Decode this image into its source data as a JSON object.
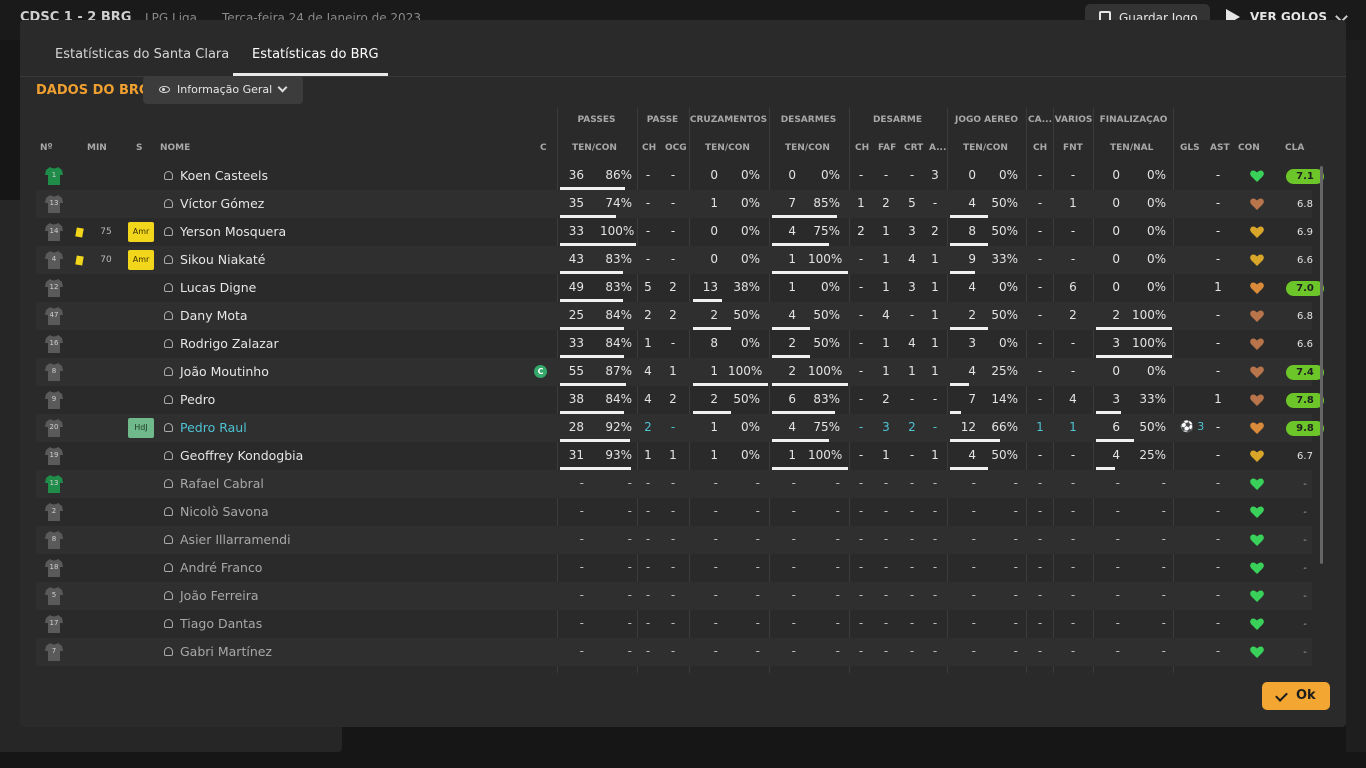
{
  "topbar": {
    "score": "CDSC 1 - 2 BRG",
    "competition": "LPG Liga",
    "date": "Terça-feira 24 de Janeiro de 2023",
    "save_label": "Guardar Jogo",
    "goals_label": "VER GOLOS"
  },
  "tabs": [
    "Estatísticas do Santa Clara",
    "Estatísticas do BRG"
  ],
  "section_title": "DADOS DO BRG",
  "view_select": "Informação Geral",
  "groups": [
    "PASSES",
    "PASSE",
    "CRUZAMENTOS",
    "DESARMES",
    "DESARME",
    "JOGO AÉREO",
    "CA...",
    "VÁRIOS",
    "FINALIZAÇÃO"
  ],
  "headers": {
    "num": "Nº",
    "min": "MIN",
    "s": "S",
    "name": "NOME",
    "c": "C",
    "passes": "TEN/CON",
    "passe_ch": "CH",
    "passe_ocg": "OCG",
    "cruz": "TEN/CON",
    "desarmes": "TEN/CON",
    "d_ch": "CH",
    "d_faf": "FAF",
    "d_crt": "CRT",
    "d_a": "A...",
    "aereo": "TEN/CON",
    "ca_ch": "CH",
    "v_fnt": "FNT",
    "finalizacao": "TEN/NAL",
    "gls": "GLS",
    "ast": "AST",
    "con": "CON",
    "cla": "CLA"
  },
  "players": [
    {
      "num": "1",
      "gk": true,
      "min": "",
      "card": false,
      "badge": "",
      "name": "Koen Casteels",
      "cap": false,
      "hl": false,
      "p_t": "36",
      "p_c": "86%",
      "p_bar": 0.86,
      "ch": "-",
      "ocg": "-",
      "cz_t": "0",
      "cz_c": "0%",
      "cz_bar": 0,
      "ds_t": "0",
      "ds_c": "0%",
      "ds_bar": 0,
      "d_ch": "-",
      "faf": "-",
      "crt": "-",
      "a": "3",
      "ae_t": "0",
      "ae_c": "0%",
      "ae_bar": 0,
      "ca_ch": "-",
      "fnt": "-",
      "f_t": "0",
      "f_c": "0%",
      "f_bar": 0,
      "gls": "",
      "ast": "-",
      "heart": "#3ad15a",
      "cla": "7.1",
      "cla_green": true
    },
    {
      "num": "13",
      "gk": false,
      "min": "",
      "card": false,
      "badge": "",
      "name": "Víctor Gómez",
      "cap": false,
      "hl": false,
      "p_t": "35",
      "p_c": "74%",
      "p_bar": 0.74,
      "ch": "-",
      "ocg": "-",
      "cz_t": "1",
      "cz_c": "0%",
      "cz_bar": 0,
      "ds_t": "7",
      "ds_c": "85%",
      "ds_bar": 0.85,
      "d_ch": "1",
      "faf": "2",
      "crt": "5",
      "a": "-",
      "ae_t": "4",
      "ae_c": "50%",
      "ae_bar": 0.5,
      "ca_ch": "-",
      "fnt": "1",
      "f_t": "0",
      "f_c": "0%",
      "f_bar": 0,
      "gls": "",
      "ast": "-",
      "heart": "#b8744a",
      "cla": "6.8",
      "cla_green": false
    },
    {
      "num": "14",
      "gk": false,
      "min": "75",
      "card": true,
      "badge": "Amr",
      "name": "Yerson Mosquera",
      "cap": false,
      "hl": false,
      "p_t": "33",
      "p_c": "100%",
      "p_bar": 1,
      "ch": "-",
      "ocg": "-",
      "cz_t": "0",
      "cz_c": "0%",
      "cz_bar": 0,
      "ds_t": "4",
      "ds_c": "75%",
      "ds_bar": 0.75,
      "d_ch": "2",
      "faf": "1",
      "crt": "3",
      "a": "2",
      "ae_t": "8",
      "ae_c": "50%",
      "ae_bar": 0.5,
      "ca_ch": "-",
      "fnt": "-",
      "f_t": "0",
      "f_c": "0%",
      "f_bar": 0,
      "gls": "",
      "ast": "-",
      "heart": "#d9a62a",
      "cla": "6.9",
      "cla_green": false
    },
    {
      "num": "4",
      "gk": false,
      "min": "70",
      "card": true,
      "badge": "Amr",
      "name": "Sikou Niakaté",
      "cap": false,
      "hl": false,
      "p_t": "43",
      "p_c": "83%",
      "p_bar": 0.83,
      "ch": "-",
      "ocg": "-",
      "cz_t": "0",
      "cz_c": "0%",
      "cz_bar": 0,
      "ds_t": "1",
      "ds_c": "100%",
      "ds_bar": 1,
      "d_ch": "-",
      "faf": "1",
      "crt": "4",
      "a": "1",
      "ae_t": "9",
      "ae_c": "33%",
      "ae_bar": 0.33,
      "ca_ch": "-",
      "fnt": "-",
      "f_t": "0",
      "f_c": "0%",
      "f_bar": 0,
      "gls": "",
      "ast": "-",
      "heart": "#d9a62a",
      "cla": "6.6",
      "cla_green": false
    },
    {
      "num": "12",
      "gk": false,
      "min": "",
      "card": false,
      "badge": "",
      "name": "Lucas Digne",
      "cap": false,
      "hl": false,
      "p_t": "49",
      "p_c": "83%",
      "p_bar": 0.83,
      "ch": "5",
      "ocg": "2",
      "cz_t": "13",
      "cz_c": "38%",
      "cz_bar": 0.38,
      "ds_t": "1",
      "ds_c": "0%",
      "ds_bar": 0,
      "d_ch": "-",
      "faf": "1",
      "crt": "3",
      "a": "1",
      "ae_t": "4",
      "ae_c": "0%",
      "ae_bar": 0,
      "ca_ch": "-",
      "fnt": "6",
      "f_t": "0",
      "f_c": "0%",
      "f_bar": 0,
      "gls": "",
      "ast": "1",
      "heart": "#d98a3a",
      "cla": "7.0",
      "cla_green": true
    },
    {
      "num": "47",
      "gk": false,
      "min": "",
      "card": false,
      "badge": "",
      "name": "Dany Mota",
      "cap": false,
      "hl": false,
      "p_t": "25",
      "p_c": "84%",
      "p_bar": 0.84,
      "ch": "2",
      "ocg": "2",
      "cz_t": "2",
      "cz_c": "50%",
      "cz_bar": 0.5,
      "ds_t": "4",
      "ds_c": "50%",
      "ds_bar": 0.5,
      "d_ch": "-",
      "faf": "4",
      "crt": "-",
      "a": "1",
      "ae_t": "2",
      "ae_c": "50%",
      "ae_bar": 0.5,
      "ca_ch": "-",
      "fnt": "2",
      "f_t": "2",
      "f_c": "100%",
      "f_bar": 1,
      "gls": "",
      "ast": "-",
      "heart": "#b8744a",
      "cla": "6.8",
      "cla_green": false
    },
    {
      "num": "16",
      "gk": false,
      "min": "",
      "card": false,
      "badge": "",
      "name": "Rodrigo Zalazar",
      "cap": false,
      "hl": false,
      "p_t": "33",
      "p_c": "84%",
      "p_bar": 0.84,
      "ch": "1",
      "ocg": "-",
      "cz_t": "8",
      "cz_c": "0%",
      "cz_bar": 0,
      "ds_t": "2",
      "ds_c": "50%",
      "ds_bar": 0.5,
      "d_ch": "-",
      "faf": "1",
      "crt": "4",
      "a": "1",
      "ae_t": "3",
      "ae_c": "0%",
      "ae_bar": 0,
      "ca_ch": "-",
      "fnt": "-",
      "f_t": "3",
      "f_c": "100%",
      "f_bar": 1,
      "gls": "",
      "ast": "-",
      "heart": "#b8744a",
      "cla": "6.6",
      "cla_green": false
    },
    {
      "num": "8",
      "gk": false,
      "min": "",
      "card": false,
      "badge": "",
      "name": "João Moutinho",
      "cap": true,
      "hl": false,
      "p_t": "55",
      "p_c": "87%",
      "p_bar": 0.87,
      "ch": "4",
      "ocg": "1",
      "cz_t": "1",
      "cz_c": "100%",
      "cz_bar": 1,
      "ds_t": "2",
      "ds_c": "100%",
      "ds_bar": 1,
      "d_ch": "-",
      "faf": "1",
      "crt": "1",
      "a": "1",
      "ae_t": "4",
      "ae_c": "25%",
      "ae_bar": 0.25,
      "ca_ch": "-",
      "fnt": "-",
      "f_t": "0",
      "f_c": "0%",
      "f_bar": 0,
      "gls": "",
      "ast": "-",
      "heart": "#b8744a",
      "cla": "7.4",
      "cla_green": true
    },
    {
      "num": "9",
      "gk": false,
      "min": "",
      "card": false,
      "badge": "",
      "name": "Pedro",
      "cap": false,
      "hl": false,
      "p_t": "38",
      "p_c": "84%",
      "p_bar": 0.84,
      "ch": "4",
      "ocg": "2",
      "cz_t": "2",
      "cz_c": "50%",
      "cz_bar": 0.5,
      "ds_t": "6",
      "ds_c": "83%",
      "ds_bar": 0.83,
      "d_ch": "-",
      "faf": "2",
      "crt": "-",
      "a": "-",
      "ae_t": "7",
      "ae_c": "14%",
      "ae_bar": 0.14,
      "ca_ch": "-",
      "fnt": "4",
      "f_t": "3",
      "f_c": "33%",
      "f_bar": 0.33,
      "gls": "",
      "ast": "1",
      "heart": "#b8744a",
      "cla": "7.8",
      "cla_green": true
    },
    {
      "num": "20",
      "gk": false,
      "min": "",
      "card": false,
      "badge": "HdJ",
      "name": "Pedro Raul",
      "cap": false,
      "hl": true,
      "p_t": "28",
      "p_c": "92%",
      "p_bar": 0.92,
      "ch": "2",
      "ocg": "-",
      "cz_t": "1",
      "cz_c": "0%",
      "cz_bar": 0,
      "ds_t": "4",
      "ds_c": "75%",
      "ds_bar": 0.75,
      "d_ch": "-",
      "faf": "3",
      "crt": "2",
      "a": "-",
      "ae_t": "12",
      "ae_c": "66%",
      "ae_bar": 0.66,
      "ca_ch": "1",
      "fnt": "1",
      "f_t": "6",
      "f_c": "50%",
      "f_bar": 0.5,
      "gls": "3",
      "ast": "-",
      "heart": "#d98a3a",
      "cla": "9.8",
      "cla_green": true
    },
    {
      "num": "19",
      "gk": false,
      "min": "",
      "card": false,
      "badge": "",
      "name": "Geoffrey Kondogbia",
      "cap": false,
      "hl": false,
      "p_t": "31",
      "p_c": "93%",
      "p_bar": 0.93,
      "ch": "1",
      "ocg": "1",
      "cz_t": "1",
      "cz_c": "0%",
      "cz_bar": 0,
      "ds_t": "1",
      "ds_c": "100%",
      "ds_bar": 1,
      "d_ch": "-",
      "faf": "1",
      "crt": "-",
      "a": "1",
      "ae_t": "4",
      "ae_c": "50%",
      "ae_bar": 0.5,
      "ca_ch": "-",
      "fnt": "-",
      "f_t": "4",
      "f_c": "25%",
      "f_bar": 0.25,
      "gls": "",
      "ast": "-",
      "heart": "#d9a62a",
      "cla": "6.7",
      "cla_green": false
    },
    {
      "num": "13",
      "gk": true,
      "min": "",
      "card": false,
      "badge": "",
      "name": "Rafael Cabral",
      "cap": false,
      "hl": false,
      "sub": true,
      "heart": "#3ad15a",
      "cla": "-",
      "cla_green": false
    },
    {
      "num": "2",
      "gk": false,
      "min": "",
      "card": false,
      "badge": "",
      "name": "Nicolò Savona",
      "cap": false,
      "hl": false,
      "sub": true,
      "heart": "#3ad15a",
      "cla": "-",
      "cla_green": false
    },
    {
      "num": "8",
      "gk": false,
      "min": "",
      "card": false,
      "badge": "",
      "name": "Asier Illarramendi",
      "cap": false,
      "hl": false,
      "sub": true,
      "heart": "#3ad15a",
      "cla": "-",
      "cla_green": false
    },
    {
      "num": "18",
      "gk": false,
      "min": "",
      "card": false,
      "badge": "",
      "name": "André Franco",
      "cap": false,
      "hl": false,
      "sub": true,
      "heart": "#3ad15a",
      "cla": "-",
      "cla_green": false
    },
    {
      "num": "5",
      "gk": false,
      "min": "",
      "card": false,
      "badge": "",
      "name": "João Ferreira",
      "cap": false,
      "hl": false,
      "sub": true,
      "heart": "#3ad15a",
      "cla": "-",
      "cla_green": false
    },
    {
      "num": "17",
      "gk": false,
      "min": "",
      "card": false,
      "badge": "",
      "name": "Tiago Dantas",
      "cap": false,
      "hl": false,
      "sub": true,
      "heart": "#3ad15a",
      "cla": "-",
      "cla_green": false
    },
    {
      "num": "7",
      "gk": false,
      "min": "",
      "card": false,
      "badge": "",
      "name": "Gabri Martínez",
      "cap": false,
      "hl": false,
      "sub": true,
      "heart": "#3ad15a",
      "cla": "-",
      "cla_green": false
    }
  ],
  "ok_label": "Ok"
}
